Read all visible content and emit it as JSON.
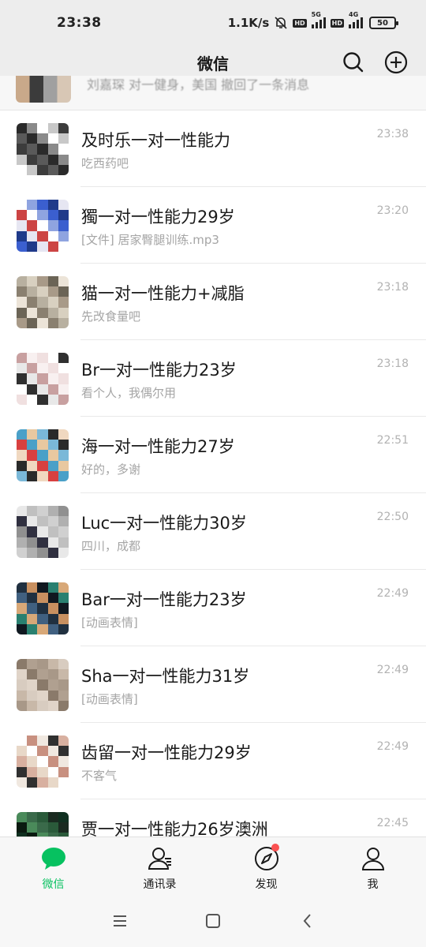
{
  "status_bar": {
    "time": "23:38",
    "net_speed": "1.1K/s",
    "battery": "50",
    "icons": [
      "mute-bell-icon",
      "hd-icon",
      "5g-signal-icon",
      "hd-icon",
      "4g-signal-icon",
      "battery-icon"
    ]
  },
  "header": {
    "title": "微信",
    "icons": [
      "search-icon",
      "add-circle-icon"
    ]
  },
  "peek_row": {
    "text": "刘嘉琛  对一健身，美国  撤回了一条消息"
  },
  "chats": [
    {
      "name": "及时乐一对一性能力",
      "preview": "吃西药吧",
      "time": "23:38"
    },
    {
      "name": "獨一对一性能力29岁",
      "preview": "[文件] 居家臀腿训练.mp3",
      "time": "23:20"
    },
    {
      "name": "猫一对一性能力+减脂",
      "preview": "先改食量吧",
      "time": "23:18"
    },
    {
      "name": "Br一对一性能力23岁",
      "preview": "看个人，我偶尔用",
      "time": "23:18"
    },
    {
      "name": "海一对一性能力27岁",
      "preview": "好的，多谢",
      "time": "22:51"
    },
    {
      "name": "Luc一对一性能力30岁",
      "preview": "四川，成都",
      "time": "22:50"
    },
    {
      "name": "Bar一对一性能力23岁",
      "preview": "[动画表情]",
      "time": "22:49"
    },
    {
      "name": "Sha一对一性能力31岁",
      "preview": "[动画表情]",
      "time": "22:49"
    },
    {
      "name": "齿留一对一性能力29岁",
      "preview": "不客气",
      "time": "22:49"
    },
    {
      "name": "贾一对一性能力26岁澳洲",
      "preview": "",
      "time": "22:45"
    }
  ],
  "tabs": [
    {
      "label": "微信",
      "icon": "chat-bubble-icon",
      "active": true
    },
    {
      "label": "通讯录",
      "icon": "contacts-icon",
      "active": false
    },
    {
      "label": "发现",
      "icon": "compass-icon",
      "active": false
    },
    {
      "label": "我",
      "icon": "person-icon",
      "active": false
    }
  ],
  "colors": {
    "accent": "#07c160",
    "header_bg": "#ededed",
    "badge": "#fa5151"
  }
}
